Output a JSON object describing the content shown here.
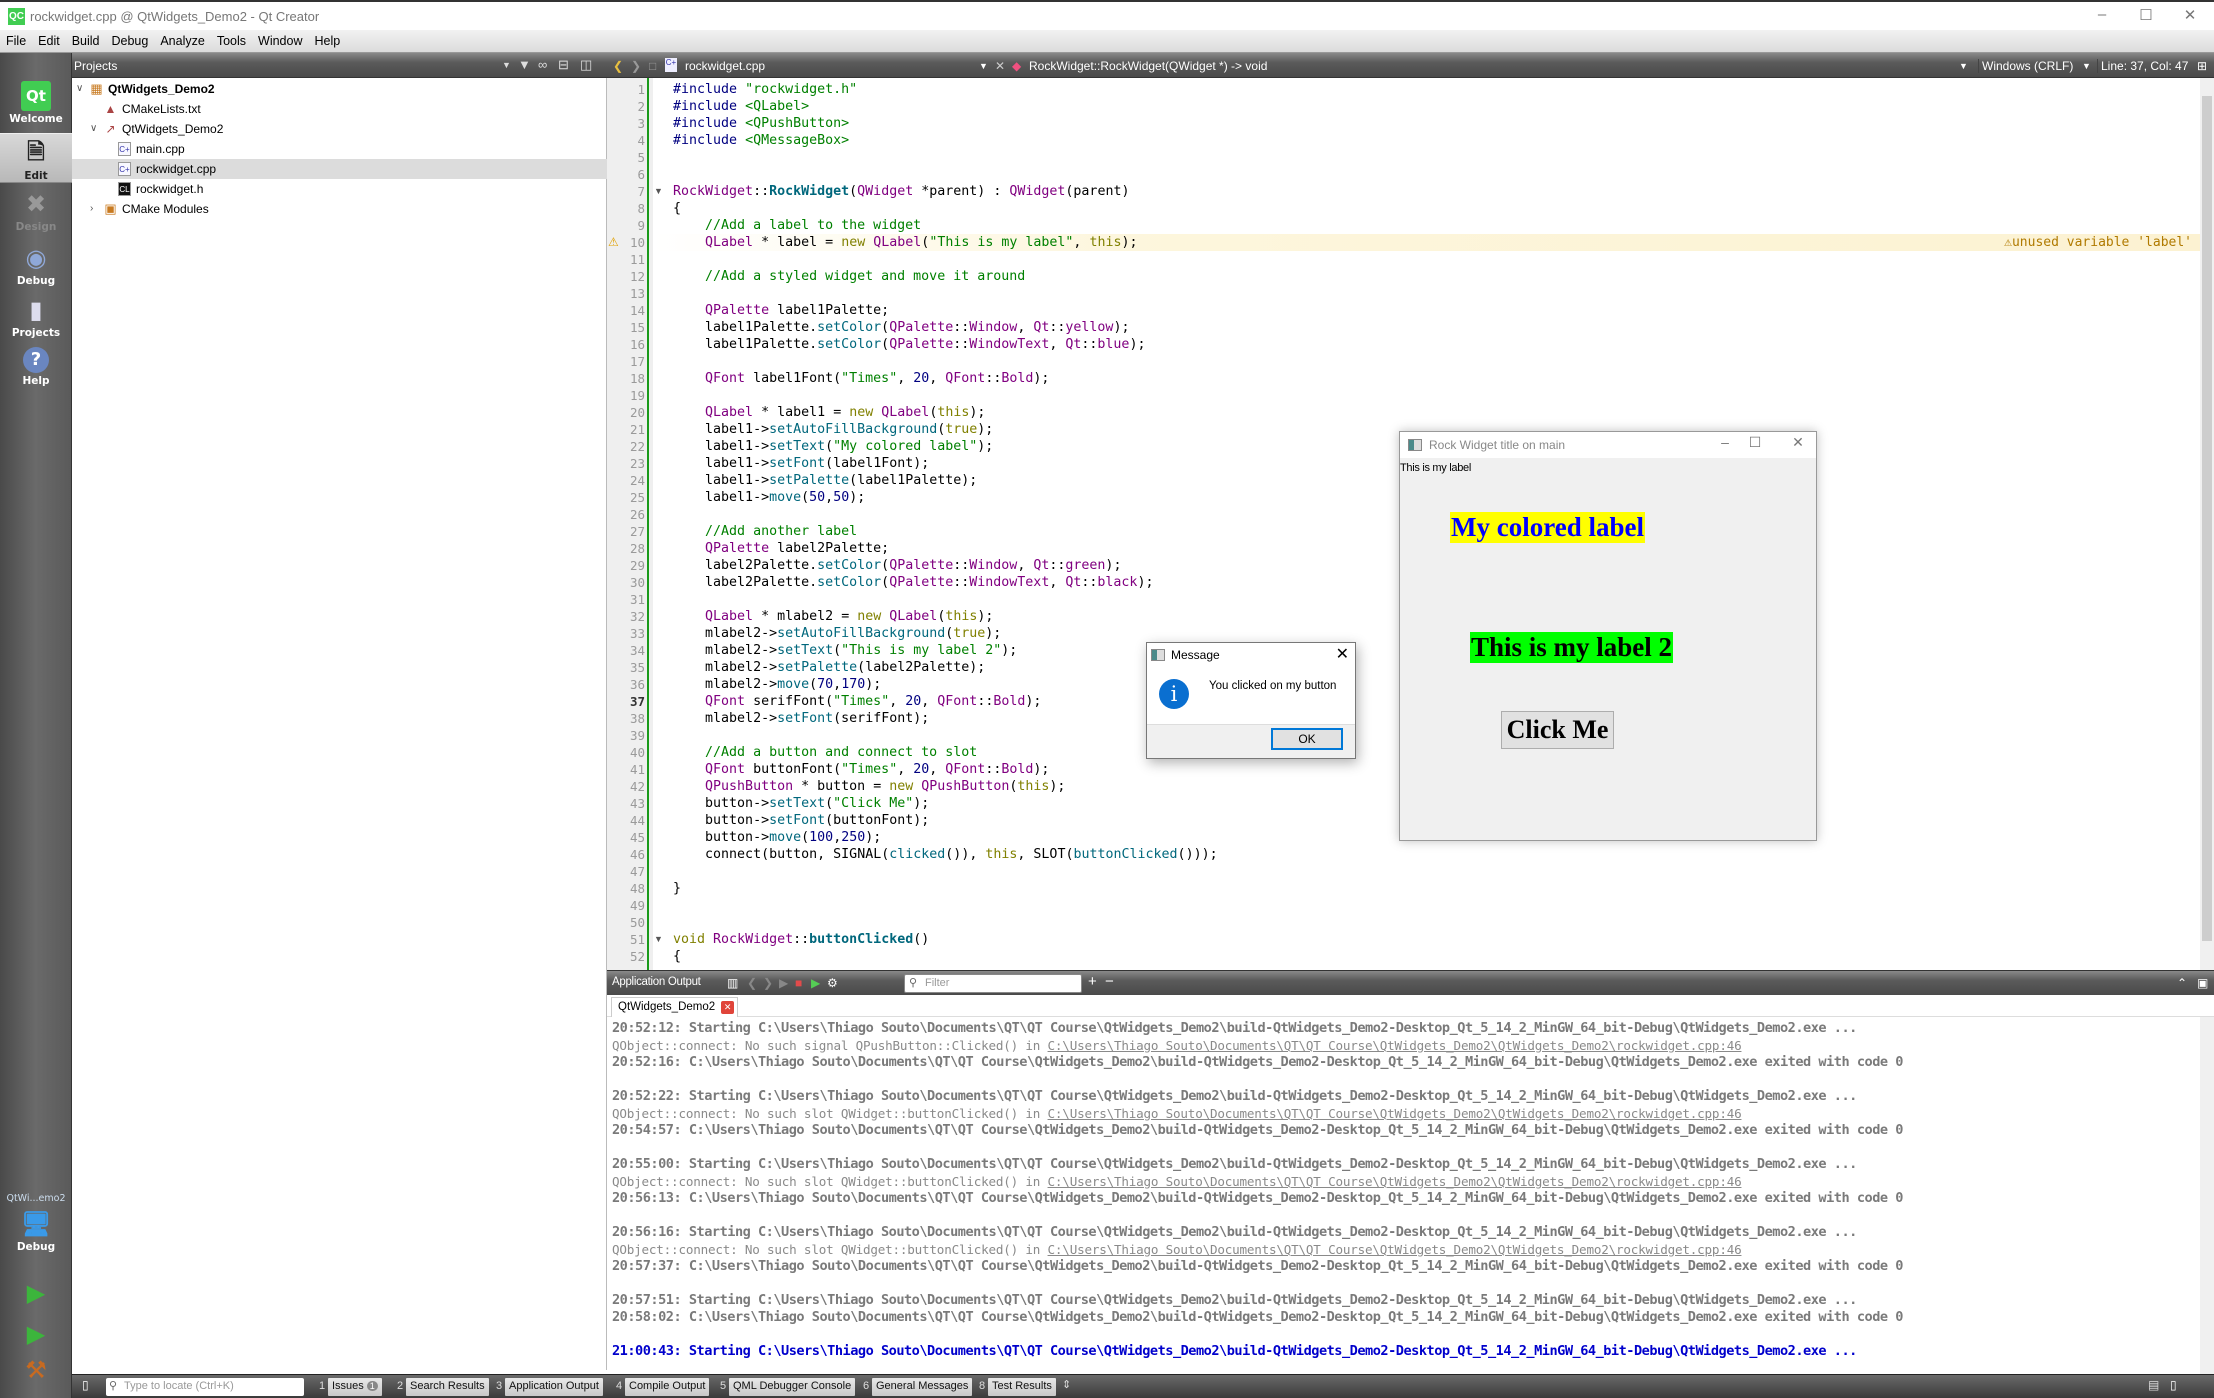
{
  "window": {
    "title": "rockwidget.cpp @ QtWidgets_Demo2 - Qt Creator",
    "logo": "QC"
  },
  "menu": [
    "File",
    "Edit",
    "Build",
    "Debug",
    "Analyze",
    "Tools",
    "Window",
    "Help"
  ],
  "modes": {
    "welcome": "Welcome",
    "edit": "Edit",
    "design": "Design",
    "debug": "Debug",
    "projects": "Projects",
    "help": "Help",
    "kit": "QtWi...emo2",
    "kit_mode": "Debug"
  },
  "projects": {
    "title": "Projects",
    "tree": [
      {
        "label": "QtWidgets_Demo2",
        "bold": true,
        "depth": 0,
        "expanded": true,
        "icon": "project-icon"
      },
      {
        "label": "CMakeLists.txt",
        "depth": 1,
        "icon": "cmake-file-icon"
      },
      {
        "label": "QtWidgets_Demo2",
        "depth": 1,
        "expanded": true,
        "icon": "target-icon"
      },
      {
        "label": "main.cpp",
        "depth": 2,
        "icon": "cpp-file-icon"
      },
      {
        "label": "rockwidget.cpp",
        "depth": 2,
        "selected": true,
        "icon": "cpp-file-icon"
      },
      {
        "label": "rockwidget.h",
        "depth": 2,
        "icon": "header-file-icon"
      },
      {
        "label": "CMake Modules",
        "depth": 1,
        "expanded": false,
        "icon": "modules-icon"
      }
    ]
  },
  "editor": {
    "file": "rockwidget.cpp",
    "symbol": "RockWidget::RockWidget(QWidget *) -> void",
    "line_ending": "Windows (CRLF)",
    "position": "Line: 37, Col: 47",
    "current_line": 37,
    "warning": {
      "line": 10,
      "text": "unused variable 'label'"
    },
    "fold_lines": [
      7,
      51
    ],
    "lines": [
      "#include \"rockwidget.h\"",
      "#include <QLabel>",
      "#include <QPushButton>",
      "#include <QMessageBox>",
      "",
      "",
      "RockWidget::RockWidget(QWidget *parent) : QWidget(parent)",
      "{",
      "    //Add a label to the widget",
      "    QLabel * label = new QLabel(\"This is my label\", this);",
      "",
      "    //Add a styled widget and move it around",
      "",
      "    QPalette label1Palette;",
      "    label1Palette.setColor(QPalette::Window, Qt::yellow);",
      "    label1Palette.setColor(QPalette::WindowText, Qt::blue);",
      "",
      "    QFont label1Font(\"Times\", 20, QFont::Bold);",
      "",
      "    QLabel * label1 = new QLabel(this);",
      "    label1->setAutoFillBackground(true);",
      "    label1->setText(\"My colored label\");",
      "    label1->setFont(label1Font);",
      "    label1->setPalette(label1Palette);",
      "    label1->move(50,50);",
      "",
      "    //Add another label",
      "    QPalette label2Palette;",
      "    label2Palette.setColor(QPalette::Window, Qt::green);",
      "    label2Palette.setColor(QPalette::WindowText, Qt::black);",
      "",
      "    QLabel * mlabel2 = new QLabel(this);",
      "    mlabel2->setAutoFillBackground(true);",
      "    mlabel2->setText(\"This is my label 2\");",
      "    mlabel2->setPalette(label2Palette);",
      "    mlabel2->move(70,170);",
      "    QFont serifFont(\"Times\", 20, QFont::Bold);",
      "    mlabel2->setFont(serifFont);",
      "",
      "    //Add a button and connect to slot",
      "    QFont buttonFont(\"Times\", 20, QFont::Bold);",
      "    QPushButton * button = new QPushButton(this);",
      "    button->setText(\"Click Me\");",
      "    button->setFont(buttonFont);",
      "    button->move(100,250);",
      "    connect(button, SIGNAL(clicked()), this, SLOT(buttonClicked()));",
      "",
      "}",
      "",
      "",
      "void RockWidget::buttonClicked()",
      "{"
    ]
  },
  "output": {
    "title": "Application Output",
    "filter_placeholder": "Filter",
    "tab": "QtWidgets_Demo2",
    "lines": [
      {
        "kind": "msg",
        "text": "20:52:12: Starting C:\\Users\\Thiago Souto\\Documents\\QT\\QT Course\\QtWidgets_Demo2\\build-QtWidgets_Demo2-Desktop_Qt_5_14_2_MinGW_64_bit-Debug\\QtWidgets_Demo2.exe ..."
      },
      {
        "kind": "dbg",
        "text": "QObject::connect: No such signal QPushButton::Clicked() in ",
        "link": "C:\\Users\\Thiago Souto\\Documents\\QT\\QT Course\\QtWidgets_Demo2\\QtWidgets_Demo2\\rockwidget.cpp:46"
      },
      {
        "kind": "msg",
        "text": "20:52:16: C:\\Users\\Thiago Souto\\Documents\\QT\\QT Course\\QtWidgets_Demo2\\build-QtWidgets_Demo2-Desktop_Qt_5_14_2_MinGW_64_bit-Debug\\QtWidgets_Demo2.exe exited with code 0"
      },
      {
        "kind": "blank",
        "text": ""
      },
      {
        "kind": "msg",
        "text": "20:52:22: Starting C:\\Users\\Thiago Souto\\Documents\\QT\\QT Course\\QtWidgets_Demo2\\build-QtWidgets_Demo2-Desktop_Qt_5_14_2_MinGW_64_bit-Debug\\QtWidgets_Demo2.exe ..."
      },
      {
        "kind": "dbg",
        "text": "QObject::connect: No such slot QWidget::buttonClicked() in ",
        "link": "C:\\Users\\Thiago Souto\\Documents\\QT\\QT Course\\QtWidgets_Demo2\\QtWidgets_Demo2\\rockwidget.cpp:46"
      },
      {
        "kind": "msg",
        "text": "20:54:57: C:\\Users\\Thiago Souto\\Documents\\QT\\QT Course\\QtWidgets_Demo2\\build-QtWidgets_Demo2-Desktop_Qt_5_14_2_MinGW_64_bit-Debug\\QtWidgets_Demo2.exe exited with code 0"
      },
      {
        "kind": "blank",
        "text": ""
      },
      {
        "kind": "msg",
        "text": "20:55:00: Starting C:\\Users\\Thiago Souto\\Documents\\QT\\QT Course\\QtWidgets_Demo2\\build-QtWidgets_Demo2-Desktop_Qt_5_14_2_MinGW_64_bit-Debug\\QtWidgets_Demo2.exe ..."
      },
      {
        "kind": "dbg",
        "text": "QObject::connect: No such slot QWidget::buttonClicked() in ",
        "link": "C:\\Users\\Thiago Souto\\Documents\\QT\\QT Course\\QtWidgets_Demo2\\QtWidgets_Demo2\\rockwidget.cpp:46"
      },
      {
        "kind": "msg",
        "text": "20:56:13: C:\\Users\\Thiago Souto\\Documents\\QT\\QT Course\\QtWidgets_Demo2\\build-QtWidgets_Demo2-Desktop_Qt_5_14_2_MinGW_64_bit-Debug\\QtWidgets_Demo2.exe exited with code 0"
      },
      {
        "kind": "blank",
        "text": ""
      },
      {
        "kind": "msg",
        "text": "20:56:16: Starting C:\\Users\\Thiago Souto\\Documents\\QT\\QT Course\\QtWidgets_Demo2\\build-QtWidgets_Demo2-Desktop_Qt_5_14_2_MinGW_64_bit-Debug\\QtWidgets_Demo2.exe ..."
      },
      {
        "kind": "dbg",
        "text": "QObject::connect: No such slot QWidget::buttonClicked() in ",
        "link": "C:\\Users\\Thiago Souto\\Documents\\QT\\QT Course\\QtWidgets_Demo2\\QtWidgets_Demo2\\rockwidget.cpp:46"
      },
      {
        "kind": "msg",
        "text": "20:57:37: C:\\Users\\Thiago Souto\\Documents\\QT\\QT Course\\QtWidgets_Demo2\\build-QtWidgets_Demo2-Desktop_Qt_5_14_2_MinGW_64_bit-Debug\\QtWidgets_Demo2.exe exited with code 0"
      },
      {
        "kind": "blank",
        "text": ""
      },
      {
        "kind": "msg",
        "text": "20:57:51: Starting C:\\Users\\Thiago Souto\\Documents\\QT\\QT Course\\QtWidgets_Demo2\\build-QtWidgets_Demo2-Desktop_Qt_5_14_2_MinGW_64_bit-Debug\\QtWidgets_Demo2.exe ..."
      },
      {
        "kind": "msg",
        "text": "20:58:02: C:\\Users\\Thiago Souto\\Documents\\QT\\QT Course\\QtWidgets_Demo2\\build-QtWidgets_Demo2-Desktop_Qt_5_14_2_MinGW_64_bit-Debug\\QtWidgets_Demo2.exe exited with code 0"
      },
      {
        "kind": "blank",
        "text": ""
      },
      {
        "kind": "current",
        "text": "21:00:43: Starting C:\\Users\\Thiago Souto\\Documents\\QT\\QT Course\\QtWidgets_Demo2\\build-QtWidgets_Demo2-Desktop_Qt_5_14_2_MinGW_64_bit-Debug\\QtWidgets_Demo2.exe ..."
      }
    ]
  },
  "statusbar": {
    "locator_placeholder": "Type to locate (Ctrl+K)",
    "tabs": [
      {
        "num": "1",
        "label": "Issues",
        "badge": "1"
      },
      {
        "num": "2",
        "label": "Search Results"
      },
      {
        "num": "3",
        "label": "Application Output"
      },
      {
        "num": "4",
        "label": "Compile Output"
      },
      {
        "num": "5",
        "label": "QML Debugger Console"
      },
      {
        "num": "6",
        "label": "General Messages"
      },
      {
        "num": "8",
        "label": "Test Results"
      }
    ]
  },
  "rock_window": {
    "title": "Rock Widget title on main",
    "plain_label": "This is my label",
    "colored_label": "My colored label",
    "label2": "This is my label 2",
    "button": "Click Me",
    "colors": {
      "label1_bg": "#ffff00",
      "label1_fg": "#0000ff",
      "label2_bg": "#00ff00",
      "label2_fg": "#000000"
    }
  },
  "message_box": {
    "title": "Message",
    "text": "You clicked on my button",
    "ok": "OK",
    "icon": "info-icon"
  }
}
